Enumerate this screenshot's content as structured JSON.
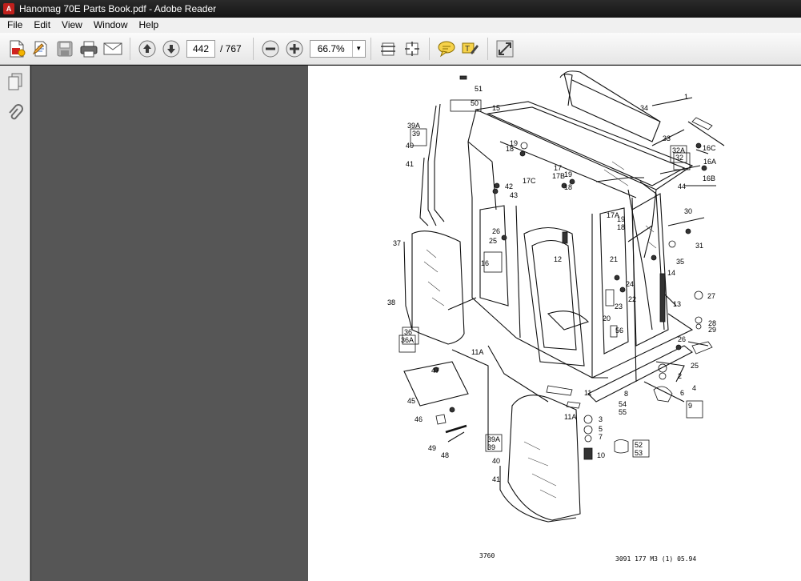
{
  "window": {
    "title": "Hanomag 70E Parts Book.pdf - Adobe Reader",
    "app_icon_glyph": "A"
  },
  "menu": [
    "File",
    "Edit",
    "View",
    "Window",
    "Help"
  ],
  "toolbar": {
    "current_page": "442",
    "total_pages": "/ 767",
    "zoom": "66.7%",
    "icons": [
      "create-pdf-icon",
      "edit-icon",
      "save-icon",
      "print-icon",
      "email-icon",
      "previous-page-icon",
      "next-page-icon",
      "zoom-out-icon",
      "zoom-in-icon",
      "fit-page-icon",
      "fit-width-icon",
      "comment-icon",
      "highlight-icon",
      "fullscreen-icon"
    ]
  },
  "nav_pane": {
    "icons": [
      "pages-icon",
      "attachments-icon"
    ]
  },
  "document": {
    "footer_left": "3760",
    "footer_right": "3091 177 M3 (1) 05.94",
    "part_labels": [
      "51",
      "50",
      "15",
      "34",
      "1",
      "39A",
      "39",
      "40",
      "41",
      "19",
      "18",
      "33",
      "32A",
      "32",
      "16C",
      "16A",
      "16B",
      "17",
      "17B",
      "17C",
      "19",
      "18",
      "42",
      "43",
      "44",
      "30",
      "17A",
      "19",
      "18",
      "31",
      "37",
      "26",
      "25",
      "12",
      "16",
      "35",
      "21",
      "14",
      "24",
      "22",
      "23",
      "27",
      "38",
      "13",
      "20",
      "56",
      "28",
      "29",
      "36",
      "36A",
      "26",
      "11A",
      "25",
      "2",
      "47",
      "45",
      "11",
      "8",
      "4",
      "6",
      "54",
      "55",
      "9",
      "46",
      "11A",
      "3",
      "5",
      "7",
      "39A",
      "39",
      "49",
      "48",
      "52",
      "53",
      "10",
      "40",
      "41"
    ]
  }
}
